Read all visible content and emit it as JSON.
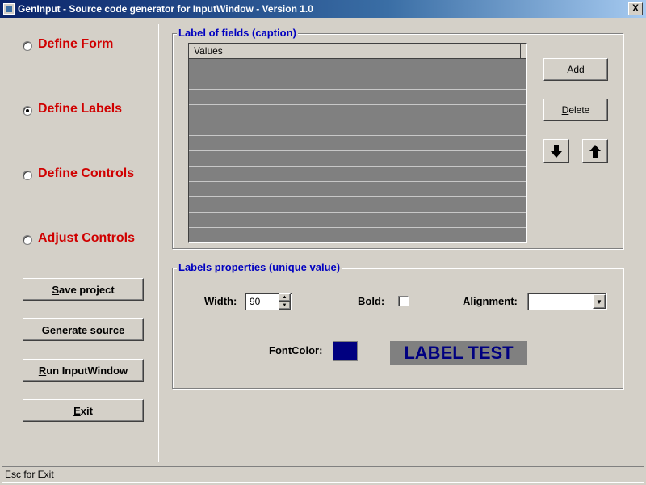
{
  "window": {
    "title": "GenInput - Source code generator for InputWindow - Version 1.0",
    "close_label": "X"
  },
  "nav": {
    "options": [
      {
        "label": "Define Form",
        "checked": false
      },
      {
        "label": "Define Labels",
        "checked": true
      },
      {
        "label": "Define Controls",
        "checked": false
      },
      {
        "label": "Adjust Controls",
        "checked": false
      }
    ],
    "accent_color": "#d00000"
  },
  "actions": {
    "save_project": "Save project",
    "generate_source": "Generate source",
    "run_inputwindow": "Run InputWindow",
    "exit": "Exit"
  },
  "fields_group": {
    "legend": "Label of fields (caption)",
    "grid_header": "Values",
    "add_label": "Add",
    "delete_label": "Delete",
    "move_down_icon": "arrow-down-icon",
    "move_up_icon": "arrow-up-icon"
  },
  "properties_group": {
    "legend": "Labels properties (unique value)",
    "width_label": "Width:",
    "width_value": "90",
    "bold_label": "Bold:",
    "bold_checked": false,
    "alignment_label": "Alignment:",
    "alignment_value": "",
    "fontcolor_label": "FontColor:",
    "font_color": "#000080",
    "preview_text": "LABEL TEST",
    "preview_bg": "#808080",
    "legend_color": "#0000c0"
  },
  "status": {
    "text": "Esc for Exit"
  }
}
